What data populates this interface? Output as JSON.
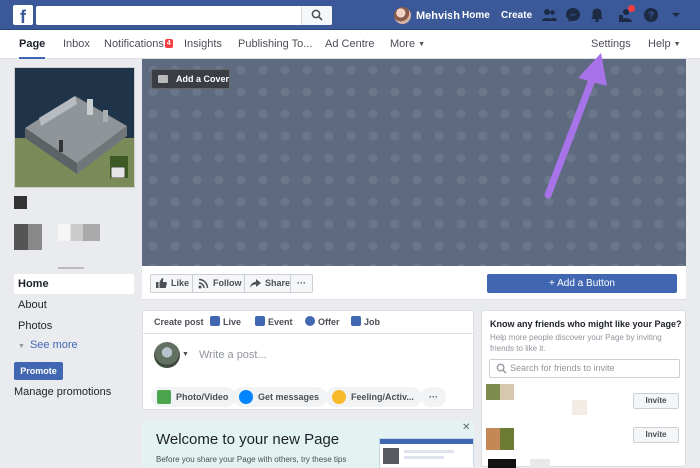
{
  "topbar": {
    "profile_name": "Mehvish",
    "nav": [
      "Home",
      "Create"
    ],
    "icons": [
      "friends-icon",
      "messenger-icon",
      "notifications-icon",
      "page-notifications-icon",
      "help-icon",
      "account-menu-icon"
    ]
  },
  "pagenav": {
    "tabs": {
      "page": "Page",
      "inbox": "Inbox",
      "notifications": "Notifications",
      "notifications_count": "4",
      "insights": "Insights",
      "publishing": "Publishing To...",
      "ad_centre": "Ad Centre",
      "more": "More"
    },
    "settings": "Settings",
    "help": "Help"
  },
  "left": {
    "nav": [
      "Home",
      "About",
      "Photos"
    ],
    "see_more": "See more",
    "promote": "Promote",
    "manage_promotions": "Manage promotions"
  },
  "cover": {
    "add_cover": "Add a Cover"
  },
  "actions": {
    "like": "Like",
    "follow": "Follow",
    "share": "Share",
    "more": "···",
    "add_button": "+ Add a Button"
  },
  "create_post": {
    "tabs": [
      "Create post",
      "Live",
      "Event",
      "Offer",
      "Job"
    ],
    "placeholder": "Write a post...",
    "pills": [
      "Photo/Video",
      "Get messages",
      "Feeling/Activ...",
      "···"
    ]
  },
  "welcome": {
    "title": "Welcome to your new Page",
    "text": "Before you share your Page with others, try these tips that",
    "close": "✕"
  },
  "friends": {
    "title": "Know any friends who might like your Page?",
    "subtitle": "Help more people discover your Page by inviting friends to like it.",
    "search_placeholder": "Search for friends to invite",
    "invite_label": "Invite"
  },
  "colors": {
    "facebook_blue": "#3b5998",
    "button_blue": "#4267b2",
    "annotation_arrow": "#a873e8"
  }
}
